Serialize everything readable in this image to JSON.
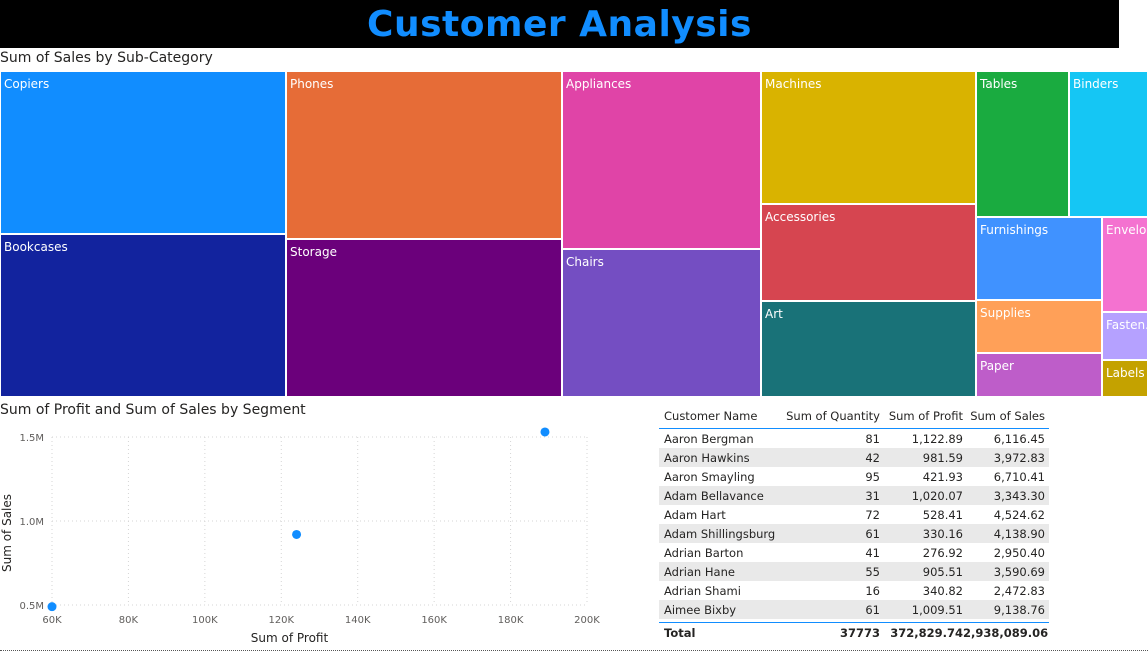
{
  "header": {
    "title": "Customer Analysis"
  },
  "treemap": {
    "title": "Sum of Sales by Sub-Category",
    "tiles": [
      {
        "label": "Copiers",
        "color": "#118DFF"
      },
      {
        "label": "Bookcases",
        "color": "#12239E"
      },
      {
        "label": "Phones",
        "color": "#E66C37"
      },
      {
        "label": "Storage",
        "color": "#6B007B"
      },
      {
        "label": "Appliances",
        "color": "#E044A7"
      },
      {
        "label": "Chairs",
        "color": "#744EC2"
      },
      {
        "label": "Machines",
        "color": "#D9B300"
      },
      {
        "label": "Accessories",
        "color": "#D64550"
      },
      {
        "label": "Art",
        "color": "#197278"
      },
      {
        "label": "Tables",
        "color": "#1AAB40"
      },
      {
        "label": "Binders",
        "color": "#15C6F4"
      },
      {
        "label": "Furnishings",
        "color": "#4092FF"
      },
      {
        "label": "Supplies",
        "color": "#FFA058"
      },
      {
        "label": "Paper",
        "color": "#BE5DC9"
      },
      {
        "label": "Envelo...",
        "color": "#F472D0"
      },
      {
        "label": "Fasten...",
        "color": "#B5A1FF"
      },
      {
        "label": "Labels",
        "color": "#C4A200"
      }
    ]
  },
  "scatter": {
    "title": "Sum of Profit and Sum of Sales by Segment",
    "xlabel": "Sum of Profit",
    "ylabel": "Sum of Sales"
  },
  "chart_data": {
    "type": "scatter",
    "title": "Sum of Profit and Sum of Sales by Segment",
    "xlabel": "Sum of Profit",
    "ylabel": "Sum of Sales",
    "xlim": [
      60000,
      200000
    ],
    "ylim": [
      500000,
      1500000
    ],
    "xticks": [
      "60K",
      "80K",
      "100K",
      "120K",
      "140K",
      "160K",
      "180K",
      "200K"
    ],
    "yticks": [
      "0.5M",
      "1.0M",
      "1.5M"
    ],
    "point_color": "#118DFF",
    "points": [
      {
        "x": 60000,
        "y": 490000
      },
      {
        "x": 124000,
        "y": 920000
      },
      {
        "x": 189000,
        "y": 1530000
      }
    ]
  },
  "table": {
    "headers": [
      "Customer Name",
      "Sum of Quantity",
      "Sum of Profit",
      "Sum of Sales"
    ],
    "rows": [
      [
        "Aaron Bergman",
        "81",
        "1,122.89",
        "6,116.45"
      ],
      [
        "Aaron Hawkins",
        "42",
        "981.59",
        "3,972.83"
      ],
      [
        "Aaron Smayling",
        "95",
        "421.93",
        "6,710.41"
      ],
      [
        "Adam Bellavance",
        "31",
        "1,020.07",
        "3,343.30"
      ],
      [
        "Adam Hart",
        "72",
        "528.41",
        "4,524.62"
      ],
      [
        "Adam Shillingsburg",
        "61",
        "330.16",
        "4,138.90"
      ],
      [
        "Adrian Barton",
        "41",
        "276.92",
        "2,950.40"
      ],
      [
        "Adrian Hane",
        "55",
        "905.51",
        "3,590.69"
      ],
      [
        "Adrian Shami",
        "16",
        "340.82",
        "2,472.83"
      ],
      [
        "Aimee Bixby",
        "61",
        "1,009.51",
        "9,138.76"
      ]
    ],
    "total": [
      "Total",
      "37773",
      "372,829.74",
      "2,938,089.06"
    ]
  }
}
